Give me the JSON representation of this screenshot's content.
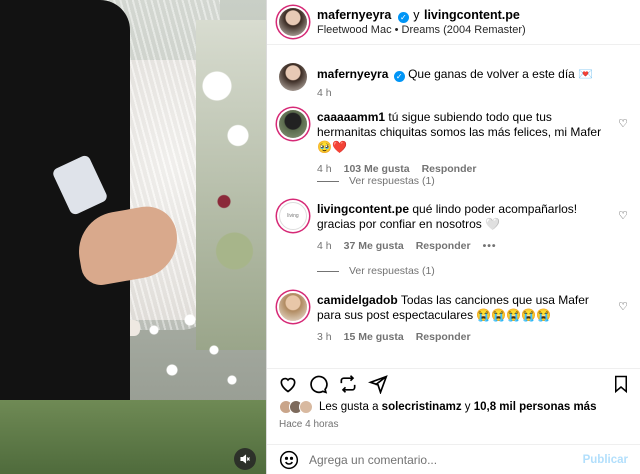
{
  "header": {
    "username": "mafernyeyra",
    "joiner": "y",
    "collab": "livingcontent.pe",
    "audio": "Fleetwood Mac • Dreams (2004 Remaster)"
  },
  "caption": {
    "username": "mafernyeyra",
    "text": "Que ganas de volver a este día 💌",
    "time": "4 h"
  },
  "comments": [
    {
      "username": "caaaaamm1",
      "text": "tú sigue subiendo todo que tus hermanitas chiquitas somos las más felices, mi Mafer🥹❤️",
      "time": "4 h",
      "likes": "103 Me gusta",
      "reply": "Responder",
      "view_replies": "Ver respuestas (1)"
    },
    {
      "username": "livingcontent.pe",
      "text": "qué lindo poder acompañarlos! gracias por confiar en nosotros 🤍",
      "time": "4 h",
      "likes": "37 Me gusta",
      "reply": "Responder",
      "more": "•••",
      "view_replies": "Ver respuestas (1)",
      "avatar_text": "living"
    },
    {
      "username": "camidelgadob",
      "text": "Todas las canciones que usa Mafer para sus post espectaculares 😭😭😭😭😭",
      "time": "3 h",
      "likes": "15 Me gusta",
      "reply": "Responder"
    }
  ],
  "likes_line": {
    "prefix": "Les gusta a",
    "user": "solecristinamz",
    "middle": "y",
    "count": "10,8 mil personas más"
  },
  "posted_time": "Hace 4 horas",
  "comment_box": {
    "placeholder": "Agrega un comentario...",
    "post_label": "Publicar"
  },
  "colors": {
    "verified": "#0095f6",
    "post_disabled": "#b2dffc",
    "muted_text": "#737373"
  }
}
